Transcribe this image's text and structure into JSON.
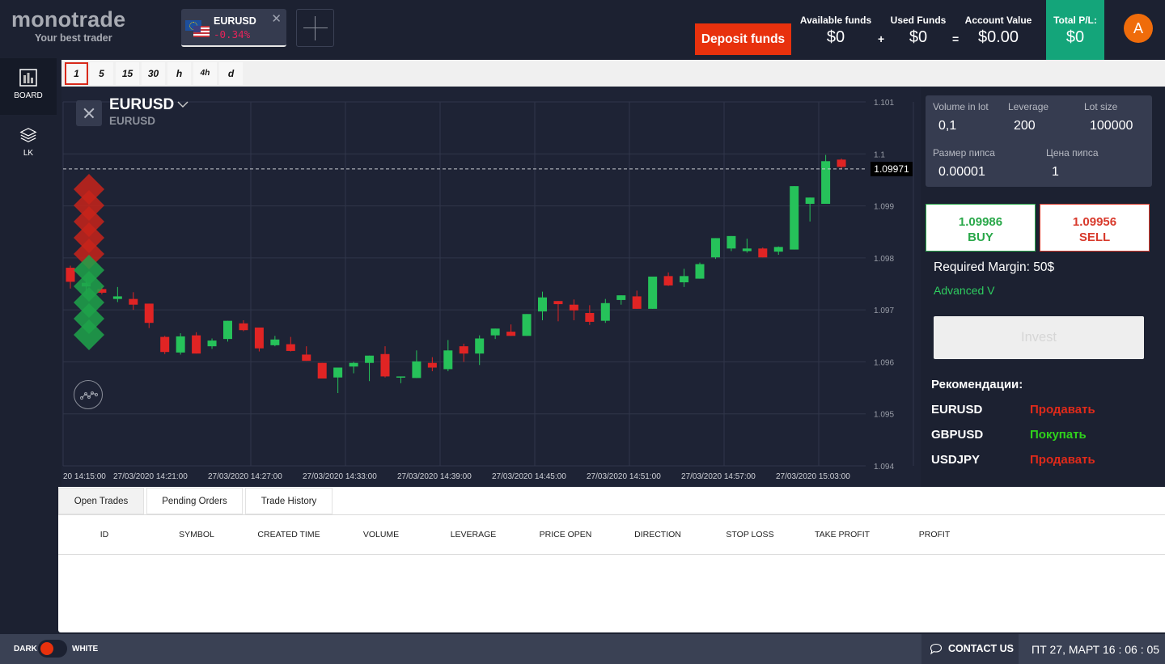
{
  "header": {
    "logo_title": "monotrade",
    "logo_subtitle": "Your best trader",
    "symbol_tab": {
      "symbol": "EURUSD",
      "change": "-0.34%",
      "change_color": "#e8235a",
      "close_icon": "close-icon"
    },
    "add_tab_icon": "plus-icon",
    "deposit_label": "Deposit funds",
    "funds": {
      "available_label": "Available funds",
      "available_value": "$0",
      "plus": "+",
      "used_label": "Used Funds",
      "used_value": "$0",
      "equals": "=",
      "account_label": "Account Value",
      "account_value": "$0.00",
      "total_pl_label": "Total P/L:",
      "total_pl_value": "$0"
    },
    "avatar_letter": "A"
  },
  "sidebar": {
    "items": [
      {
        "label": "BOARD",
        "icon": "bar-chart-icon",
        "active": true
      },
      {
        "label": "LK",
        "icon": "layers-icon",
        "active": false
      }
    ]
  },
  "timeframes": {
    "items": [
      "1",
      "5",
      "15",
      "30",
      "h",
      "4h",
      "d"
    ],
    "selected": "1"
  },
  "chart": {
    "symbol": "EURUSD",
    "subtitle": "EURUSD",
    "current_price_label": "1.09971"
  },
  "chart_data": {
    "type": "candlestick",
    "title": "EURUSD",
    "ylim": [
      1.094,
      1.101
    ],
    "y_ticks": [
      "1.101",
      "1.1",
      "1.099",
      "1.098",
      "1.097",
      "1.096",
      "1.095",
      "1.094"
    ],
    "x_ticks": [
      "27/03/2020 14:15:00",
      "27/03/2020 14:21:00",
      "27/03/2020 14:27:00",
      "27/03/2020 14:33:00",
      "27/03/2020 14:39:00",
      "27/03/2020 14:45:00",
      "27/03/2020 14:51:00",
      "27/03/2020 14:57:00",
      "27/03/2020 15:03:00"
    ],
    "x_first_tick_visible": "20 14:15:00",
    "grid": true,
    "current_price": 1.09971,
    "up_color": "#26c25a",
    "down_color": "#e02424",
    "candles": [
      {
        "o": 1.09781,
        "h": 1.09785,
        "l": 1.09741,
        "c": 1.09754
      },
      {
        "o": 1.09745,
        "h": 1.0976,
        "l": 1.0973,
        "c": 1.09752
      },
      {
        "o": 1.0974,
        "h": 1.09745,
        "l": 1.0973,
        "c": 1.09733
      },
      {
        "o": 1.09721,
        "h": 1.09744,
        "l": 1.09715,
        "c": 1.09726
      },
      {
        "o": 1.09721,
        "h": 1.09734,
        "l": 1.097,
        "c": 1.0971
      },
      {
        "o": 1.09712,
        "h": 1.09712,
        "l": 1.09665,
        "c": 1.09675
      },
      {
        "o": 1.09648,
        "h": 1.0965,
        "l": 1.09615,
        "c": 1.09619
      },
      {
        "o": 1.09618,
        "h": 1.09655,
        "l": 1.09614,
        "c": 1.09649
      },
      {
        "o": 1.09651,
        "h": 1.09657,
        "l": 1.09616,
        "c": 1.09616
      },
      {
        "o": 1.0963,
        "h": 1.09645,
        "l": 1.09625,
        "c": 1.09641
      },
      {
        "o": 1.09644,
        "h": 1.09675,
        "l": 1.09639,
        "c": 1.09679
      },
      {
        "o": 1.09674,
        "h": 1.0968,
        "l": 1.09659,
        "c": 1.09661
      },
      {
        "o": 1.09666,
        "h": 1.09666,
        "l": 1.0962,
        "c": 1.09626
      },
      {
        "o": 1.09632,
        "h": 1.0965,
        "l": 1.0963,
        "c": 1.09643
      },
      {
        "o": 1.09634,
        "h": 1.09648,
        "l": 1.0962,
        "c": 1.09621
      },
      {
        "o": 1.09614,
        "h": 1.0963,
        "l": 1.0961,
        "c": 1.09602
      },
      {
        "o": 1.09598,
        "h": 1.09598,
        "l": 1.0957,
        "c": 1.09568
      },
      {
        "o": 1.0957,
        "h": 1.09585,
        "l": 1.0954,
        "c": 1.09589
      },
      {
        "o": 1.09591,
        "h": 1.096,
        "l": 1.09578,
        "c": 1.09598
      },
      {
        "o": 1.09598,
        "h": 1.0961,
        "l": 1.09563,
        "c": 1.09612
      },
      {
        "o": 1.09615,
        "h": 1.0963,
        "l": 1.0957,
        "c": 1.09572
      },
      {
        "o": 1.09571,
        "h": 1.09572,
        "l": 1.09559,
        "c": 1.09572
      },
      {
        "o": 1.09569,
        "h": 1.09622,
        "l": 1.09569,
        "c": 1.09601
      },
      {
        "o": 1.09598,
        "h": 1.09609,
        "l": 1.09582,
        "c": 1.09589
      },
      {
        "o": 1.09586,
        "h": 1.09642,
        "l": 1.09582,
        "c": 1.09622
      },
      {
        "o": 1.0963,
        "h": 1.09635,
        "l": 1.096,
        "c": 1.09616
      },
      {
        "o": 1.09616,
        "h": 1.09651,
        "l": 1.09594,
        "c": 1.09645
      },
      {
        "o": 1.09651,
        "h": 1.09662,
        "l": 1.09644,
        "c": 1.09664
      },
      {
        "o": 1.09658,
        "h": 1.09672,
        "l": 1.09658,
        "c": 1.0965
      },
      {
        "o": 1.0965,
        "h": 1.09687,
        "l": 1.09651,
        "c": 1.09692
      },
      {
        "o": 1.09697,
        "h": 1.09735,
        "l": 1.0968,
        "c": 1.09724
      },
      {
        "o": 1.09717,
        "h": 1.09717,
        "l": 1.09678,
        "c": 1.09711
      },
      {
        "o": 1.0971,
        "h": 1.0972,
        "l": 1.0968,
        "c": 1.09699
      },
      {
        "o": 1.09694,
        "h": 1.09709,
        "l": 1.09671,
        "c": 1.09677
      },
      {
        "o": 1.09679,
        "h": 1.09721,
        "l": 1.09675,
        "c": 1.09713
      },
      {
        "o": 1.09719,
        "h": 1.09728,
        "l": 1.0971,
        "c": 1.09728
      },
      {
        "o": 1.09726,
        "h": 1.09737,
        "l": 1.09712,
        "c": 1.09702
      },
      {
        "o": 1.09702,
        "h": 1.09762,
        "l": 1.09702,
        "c": 1.09764
      },
      {
        "o": 1.09765,
        "h": 1.09772,
        "l": 1.09746,
        "c": 1.09747
      },
      {
        "o": 1.09753,
        "h": 1.09779,
        "l": 1.09744,
        "c": 1.09765
      },
      {
        "o": 1.0976,
        "h": 1.09791,
        "l": 1.0976,
        "c": 1.09788
      },
      {
        "o": 1.09801,
        "h": 1.09801,
        "l": 1.09798,
        "c": 1.09838
      },
      {
        "o": 1.09818,
        "h": 1.09842,
        "l": 1.09813,
        "c": 1.09842
      },
      {
        "o": 1.09813,
        "h": 1.09837,
        "l": 1.0981,
        "c": 1.09818
      },
      {
        "o": 1.09818,
        "h": 1.0982,
        "l": 1.0981,
        "c": 1.09801
      },
      {
        "o": 1.09812,
        "h": 1.09822,
        "l": 1.09806,
        "c": 1.09821
      },
      {
        "o": 1.09816,
        "h": 1.09816,
        "l": 1.09816,
        "c": 1.09938
      },
      {
        "o": 1.09904,
        "h": 1.09911,
        "l": 1.0987,
        "c": 1.09916
      },
      {
        "o": 1.09904,
        "h": 1.09998,
        "l": 1.09904,
        "c": 1.09986
      },
      {
        "o": 1.09989,
        "h": 1.09991,
        "l": 1.0997,
        "c": 1.09975
      }
    ]
  },
  "trade_params": {
    "volume_label": "Volume in lot",
    "volume_value": "0,1",
    "leverage_label": "Leverage",
    "leverage_value": "200",
    "lot_size_label": "Lot size",
    "lot_size_value": "100000",
    "pip_size_label": "Размер пипса",
    "pip_size_value": "0.00001",
    "pip_price_label": "Цена пипса",
    "pip_price_value": "1"
  },
  "buy": {
    "price": "1.09986",
    "label": "BUY",
    "color": "#2aa84a"
  },
  "sell": {
    "price": "1.09956",
    "label": "SELL",
    "color": "#d83a2c"
  },
  "required_margin": "Required Margin: 50$",
  "advanced_label": "Advanced V",
  "invest_label": "Invest",
  "recommendations": {
    "title": "Рекомендации:",
    "rows": [
      {
        "symbol": "EURUSD",
        "action": "Продавать",
        "color": "#e02a1a"
      },
      {
        "symbol": "GBPUSD",
        "action": "Покупать",
        "color": "#2fd11c"
      },
      {
        "symbol": "USDJPY",
        "action": "Продавать",
        "color": "#e02a1a"
      }
    ]
  },
  "bottom_panel": {
    "tabs": [
      "Open Trades",
      "Pending Orders",
      "Trade History"
    ],
    "active_tab": "Open Trades",
    "columns": [
      "ID",
      "SYMBOL",
      "CREATED TIME",
      "VOLUME",
      "LEVERAGE",
      "PRICE OPEN",
      "DIRECTION",
      "STOP LOSS",
      "TAKE PROFIT",
      "PROFIT"
    ],
    "rows": []
  },
  "footer": {
    "dark_label": "DARK",
    "white_label": "WHITE",
    "theme_dark_on": true,
    "contact_label": "CONTACT US",
    "datetime": "ПТ 27, МАРТ 16 : 06 : 05"
  }
}
